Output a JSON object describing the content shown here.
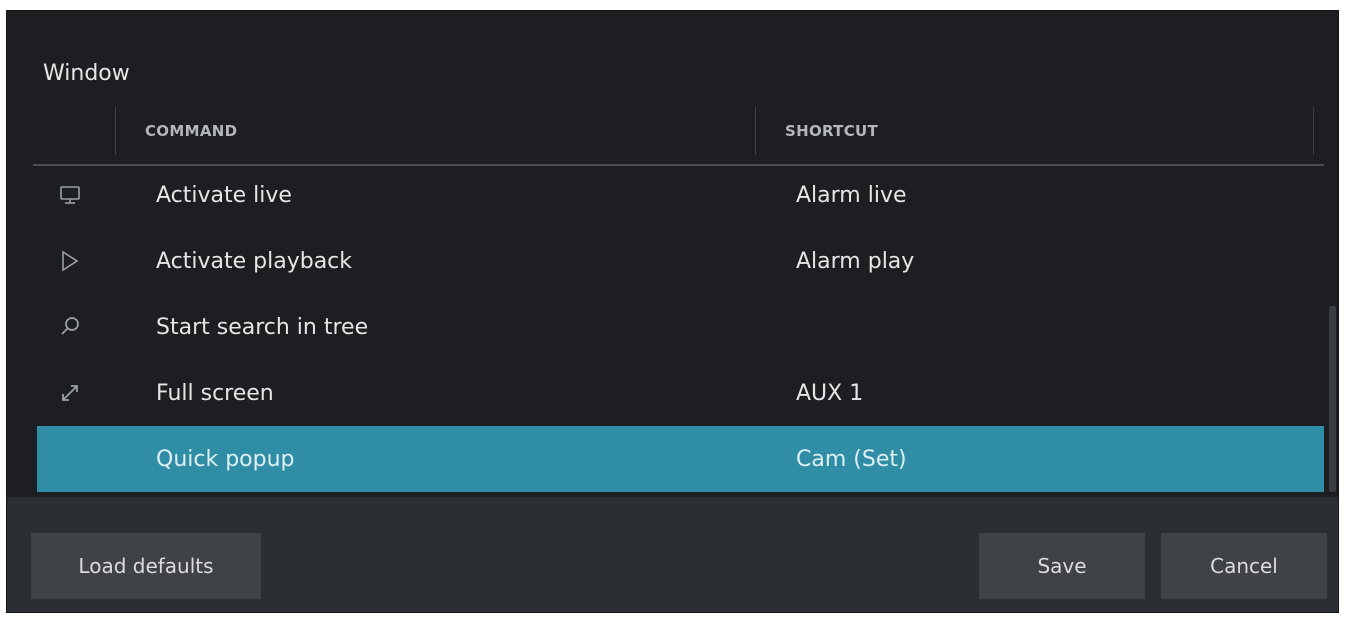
{
  "section": {
    "title": "Window"
  },
  "table": {
    "headers": {
      "command": "COMMAND",
      "shortcut": "SHORTCUT"
    },
    "rows": [
      {
        "icon": "monitor-icon",
        "command": "Activate live",
        "shortcut": "Alarm live",
        "selected": false
      },
      {
        "icon": "play-icon",
        "command": "Activate playback",
        "shortcut": "Alarm play",
        "selected": false
      },
      {
        "icon": "search-icon",
        "command": "Start search in tree",
        "shortcut": "",
        "selected": false
      },
      {
        "icon": "fullscreen-icon",
        "command": "Full screen",
        "shortcut": "AUX 1",
        "selected": false
      },
      {
        "icon": "",
        "command": "Quick popup",
        "shortcut": "Cam (Set)",
        "selected": true
      }
    ]
  },
  "footer": {
    "load_defaults_label": "Load defaults",
    "save_label": "Save",
    "cancel_label": "Cancel"
  },
  "colors": {
    "background": "#1c1e21",
    "selection": "#2f8ea6",
    "footer": "#2b2e32",
    "button": "#3f4246"
  }
}
